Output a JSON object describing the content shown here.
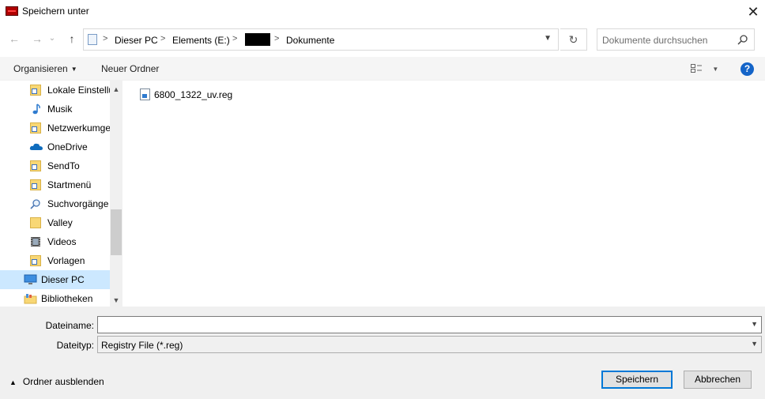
{
  "window": {
    "title": "Speichern unter",
    "close_glyph": "✕"
  },
  "nav": {
    "back_glyph": "←",
    "forward_glyph": "→",
    "recent_glyph": "⌄",
    "up_glyph": "↑",
    "breadcrumbs": [
      "Dieser PC",
      "Elements (E:)",
      "Dokumente"
    ],
    "breadcrumb_separator": ">",
    "refresh_glyph": "↻",
    "search_placeholder": "Dokumente durchsuchen"
  },
  "toolbar": {
    "organize_label": "Organisieren",
    "new_folder_label": "Neuer Ordner",
    "help_label": "?"
  },
  "tree": [
    {
      "label": "Lokale Einstellungen",
      "icon": "shortcut-folder-icon"
    },
    {
      "label": "Musik",
      "icon": "music-icon"
    },
    {
      "label": "Netzwerkumgebung",
      "icon": "shortcut-folder-icon"
    },
    {
      "label": "OneDrive",
      "icon": "cloud-icon"
    },
    {
      "label": "SendTo",
      "icon": "shortcut-folder-icon"
    },
    {
      "label": "Startmenü",
      "icon": "shortcut-folder-icon"
    },
    {
      "label": "Suchvorgänge",
      "icon": "search-icon"
    },
    {
      "label": "Valley",
      "icon": "folder-icon"
    },
    {
      "label": "Videos",
      "icon": "video-icon"
    },
    {
      "label": "Vorlagen",
      "icon": "shortcut-folder-icon"
    },
    {
      "label": "Dieser PC",
      "icon": "computer-icon",
      "selected": true
    },
    {
      "label": "Bibliotheken",
      "icon": "library-icon"
    }
  ],
  "files": [
    {
      "name": "6800_1322_uv.reg",
      "icon": "registry-file-icon"
    }
  ],
  "form": {
    "filename_label": "Dateiname:",
    "filename_value": "",
    "filetype_label": "Dateityp:",
    "filetype_value": "Registry File (*.reg)"
  },
  "footer": {
    "hide_folders_label": "Ordner ausblenden",
    "save_label": "Speichern",
    "cancel_label": "Abbrechen"
  },
  "colors": {
    "accent": "#0078d7",
    "selection": "#cce8ff",
    "help": "#1464c8"
  }
}
